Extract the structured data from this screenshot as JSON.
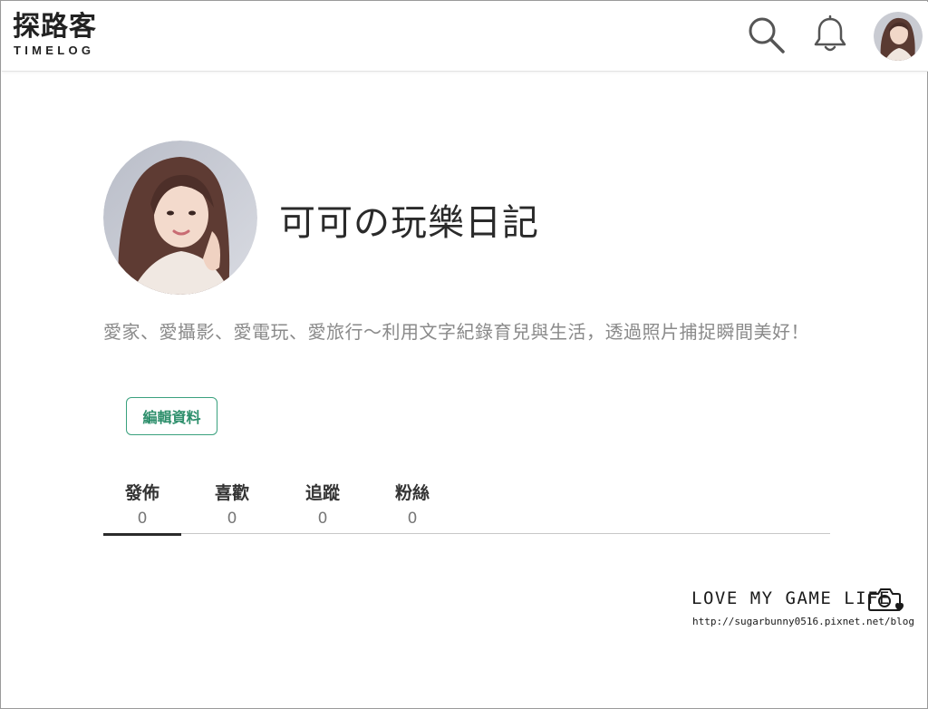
{
  "header": {
    "logo_cn": "探路客",
    "logo_en": "TIMELOG",
    "search_icon": "search-icon",
    "notification_icon": "bell-icon",
    "avatar_icon": "user-avatar"
  },
  "profile": {
    "name": "可可の玩樂日記",
    "bio": "愛家、愛攝影、愛電玩、愛旅行～利用文字紀錄育兒與生活，透過照片捕捉瞬間美好！",
    "edit_button": "編輯資料"
  },
  "tabs": [
    {
      "label": "發佈",
      "count": "0",
      "active": true
    },
    {
      "label": "喜歡",
      "count": "0",
      "active": false
    },
    {
      "label": "追蹤",
      "count": "0",
      "active": false
    },
    {
      "label": "粉絲",
      "count": "0",
      "active": false
    }
  ],
  "watermark": {
    "title": "LOVE MY GAME LIFE",
    "url": "http://sugarbunny0516.pixnet.net/blog"
  },
  "colors": {
    "accent_green": "#3aa17e",
    "text_dark": "#2a2a2a",
    "text_muted": "#8a8a8a"
  }
}
